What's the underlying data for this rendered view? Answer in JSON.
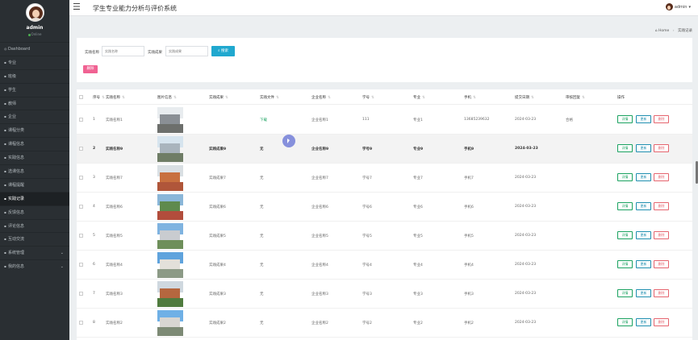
{
  "app": {
    "title": "学生专业能力分析与评价系统",
    "menu_icon": "hamburger-icon"
  },
  "user": {
    "name": "admin",
    "status": "Online",
    "top_name": "admin"
  },
  "sidebar": {
    "items": [
      {
        "label": "Dashboard",
        "icon": "dashboard-icon"
      },
      {
        "label": "专业",
        "icon": "folder-icon"
      },
      {
        "label": "班级",
        "icon": "folder-icon"
      },
      {
        "label": "学生",
        "icon": "user-icon"
      },
      {
        "label": "教师",
        "icon": "user-icon"
      },
      {
        "label": "企业",
        "icon": "building-icon"
      },
      {
        "label": "课程分类",
        "icon": "list-icon"
      },
      {
        "label": "课程信息",
        "icon": "book-icon"
      },
      {
        "label": "实践信息",
        "icon": "book-icon"
      },
      {
        "label": "选课信息",
        "icon": "check-icon"
      },
      {
        "label": "课程提醒",
        "icon": "bell-icon"
      },
      {
        "label": "实践记录",
        "icon": "record-icon"
      },
      {
        "label": "反馈信息",
        "icon": "comment-icon"
      },
      {
        "label": "评论信息",
        "icon": "comment-icon"
      },
      {
        "label": "互动交流",
        "icon": "chat-icon"
      },
      {
        "label": "系统管理",
        "icon": "gear-icon"
      },
      {
        "label": "我的信息",
        "icon": "user-icon"
      }
    ],
    "active_index": 11
  },
  "breadcrumb": {
    "home": "Home",
    "current": "实践记录"
  },
  "search": {
    "field1_label": "实践名称",
    "field1_placeholder": "实践名称",
    "field2_label": "实践成果",
    "field2_placeholder": "实践成果",
    "search_button": "搜索",
    "delete_button": "删除"
  },
  "table": {
    "headers": {
      "index": "序号",
      "name": "实践名称",
      "image": "图片信息",
      "result": "实践成果",
      "doc": "实践文件",
      "company": "企业名称",
      "student_no": "学号",
      "major": "专业",
      "phone": "手机",
      "submit_date": "提交日期",
      "review": "审核回复",
      "ops": "操作"
    },
    "actions": {
      "detail": "详情",
      "edit": "更新",
      "delete": "删除"
    },
    "rows": [
      {
        "index": "1",
        "name": "实践名称1",
        "result": "",
        "doc": "下载",
        "company": "企业名称1",
        "student_no": "111",
        "major": "专业1",
        "phone": "13685239632",
        "submit_date": "2024-03-23",
        "review": "合格",
        "sky": "#e8ecef",
        "bld": "#8a8f95",
        "grd": "#6d6f6c"
      },
      {
        "index": "2",
        "name": "实践名称9",
        "result": "实践成果9",
        "doc": "无",
        "company": "企业名称9",
        "student_no": "学号9",
        "major": "专业9",
        "phone": "手机9",
        "submit_date": "2024-03-23",
        "review": "",
        "sky": "#d6e4ee",
        "bld": "#a9b4bd",
        "grd": "#6f7d66"
      },
      {
        "index": "3",
        "name": "实践名称7",
        "result": "实践成果7",
        "doc": "无",
        "company": "企业名称7",
        "student_no": "学号7",
        "major": "专业7",
        "phone": "手机7",
        "submit_date": "2024-03-23",
        "review": "",
        "sky": "#d9dfe3",
        "bld": "#c8703f",
        "grd": "#b0563a"
      },
      {
        "index": "4",
        "name": "实践名称6",
        "result": "实践成果6",
        "doc": "无",
        "company": "企业名称6",
        "student_no": "学号6",
        "major": "专业6",
        "phone": "手机6",
        "submit_date": "2024-03-23",
        "review": "",
        "sky": "#8ab6d8",
        "bld": "#5f8a4d",
        "grd": "#b24d3c"
      },
      {
        "index": "5",
        "name": "实践名称5",
        "result": "实践成果5",
        "doc": "无",
        "company": "企业名称5",
        "student_no": "学号5",
        "major": "专业5",
        "phone": "手机5",
        "submit_date": "2024-03-23",
        "review": "",
        "sky": "#7fb3e0",
        "bld": "#c9ccd0",
        "grd": "#6e8f5a"
      },
      {
        "index": "6",
        "name": "实践名称4",
        "result": "实践成果4",
        "doc": "无",
        "company": "企业名称4",
        "student_no": "学号4",
        "major": "专业4",
        "phone": "手机4",
        "submit_date": "2024-03-23",
        "review": "",
        "sky": "#5fa3dd",
        "bld": "#e3e0da",
        "grd": "#8c9a86"
      },
      {
        "index": "7",
        "name": "实践名称3",
        "result": "实践成果3",
        "doc": "无",
        "company": "企业名称3",
        "student_no": "学号3",
        "major": "专业3",
        "phone": "手机3",
        "submit_date": "2024-03-23",
        "review": "",
        "sky": "#cfd8df",
        "bld": "#b5673f",
        "grd": "#4f7b3e"
      },
      {
        "index": "8",
        "name": "实践名称2",
        "result": "实践成果2",
        "doc": "无",
        "company": "企业名称2",
        "student_no": "学号2",
        "major": "专业2",
        "phone": "手机2",
        "submit_date": "2024-03-23",
        "review": "",
        "sky": "#6fb0e6",
        "bld": "#d8d6d2",
        "grd": "#7d8a75"
      }
    ]
  },
  "colors": {
    "sidebar_bg": "#2a2f33",
    "search_button": "#20a8cf",
    "delete_button": "#f06292",
    "detail_action": "#1aa260",
    "edit_action": "#1f8fb0",
    "delete_action": "#e5646e"
  }
}
